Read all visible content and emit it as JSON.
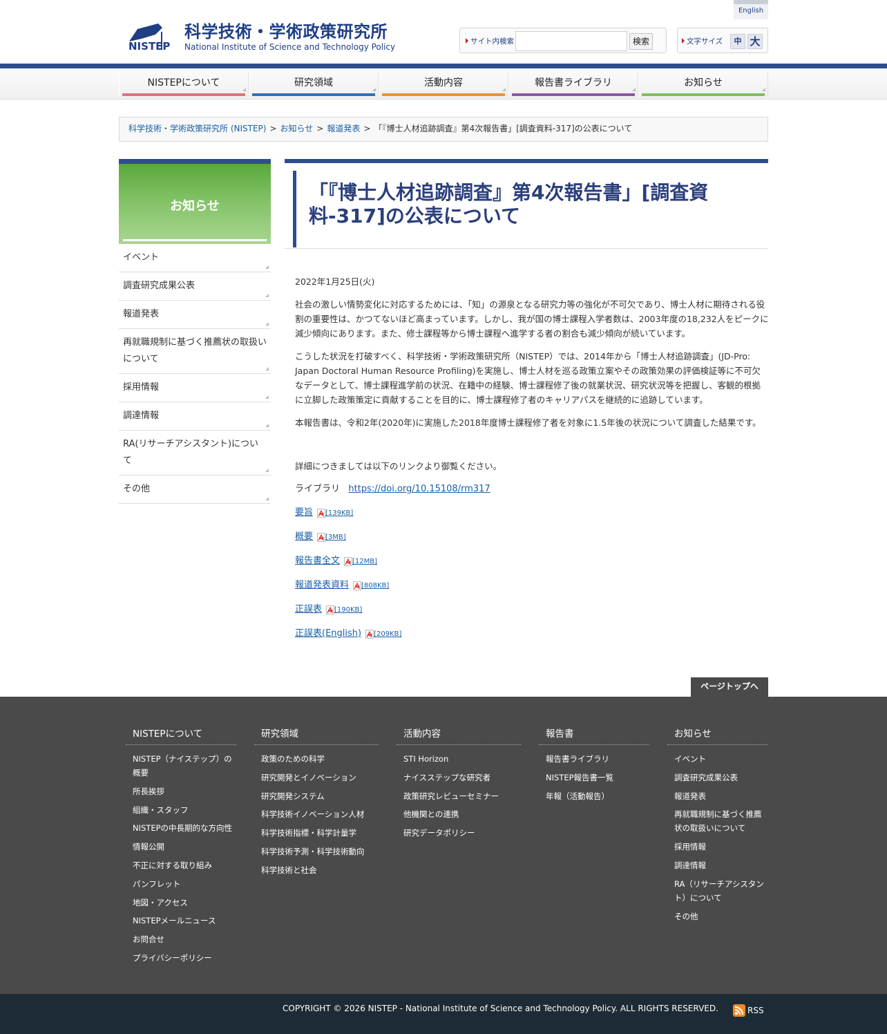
{
  "header": {
    "logo_ja": "科学技術・学術政策研究所",
    "logo_en": "National Institute of Science and Technology Policy",
    "logo_mark": "NISTEP",
    "english_link": "English",
    "search_label": "サイト内検索",
    "search_value": "",
    "search_button": "検索",
    "fontsize_label": "文字サイズ",
    "fontsize_mid": "中",
    "fontsize_big": "大"
  },
  "nav": {
    "items": [
      {
        "label": "NISTEPについて",
        "color": "#e0707a"
      },
      {
        "label": "研究領域",
        "color": "#2f6fb8"
      },
      {
        "label": "活動内容",
        "color": "#e8933a"
      },
      {
        "label": "報告書ライブラリ",
        "color": "#8a57a8"
      },
      {
        "label": "お知らせ",
        "color": "#7fbf5a"
      }
    ]
  },
  "breadcrumb": {
    "items": [
      "科学技術・学術政策研究所 (NISTEP)",
      "お知らせ",
      "報道発表"
    ],
    "current": "「『博士人材追跡調査』第4次報告書」[調査資料-317]の公表について",
    "sep": ">"
  },
  "sidebar": {
    "title": "お知らせ",
    "items": [
      {
        "label": "イベント"
      },
      {
        "label": "調査研究成果公表"
      },
      {
        "label": "報道発表"
      },
      {
        "label": "再就職規制に基づく推薦状の取扱いについて"
      },
      {
        "label": "採用情報"
      },
      {
        "label": "調達情報"
      },
      {
        "label": "RA(リサーチアシスタント)について"
      },
      {
        "label": "その他"
      }
    ]
  },
  "main": {
    "title": "「『博士人材追跡調査』第4次報告書」[調査資料-317]の公表について",
    "date": "2022年1月25日(火)",
    "paragraphs": [
      "社会の激しい情勢変化に対応するためには、「知」の源泉となる研究力等の強化が不可欠であり、博士人材に期待される役割の重要性は、かつてないほど高まっています。しかし、我が国の博士課程入学者数は、2003年度の18,232人をピークに減少傾向にあります。また、修士課程等から博士課程へ進学する者の割合も減少傾向が続いています。",
      "こうした状況を打破すべく、科学技術・学術政策研究所（NISTEP）では、2014年から「博士人材追跡調査」(JD-Pro: Japan Doctoral Human Resource Profiling)を実施し、博士人材を巡る政策立案やその政策効果の評価検証等に不可欠なデータとして、博士課程進学前の状況、在籍中の経験、博士課程修了後の就業状況、研究状況等を把握し、客観的根拠に立脚した政策策定に貢献することを目的に、博士課程修了者のキャリアパスを継続的に追跡しています。",
      "本報告書は、令和2年(2020年)に実施した2018年度博士課程修了者を対象に1.5年後の状況について調査した結果です。"
    ],
    "detail_text": "詳細につきましては以下のリンクより御覧ください。",
    "library_label": "ライブラリ",
    "library_url": "https://doi.org/10.15108/rm317",
    "links": [
      {
        "label": "要旨",
        "size": "[139KB]"
      },
      {
        "label": "概要",
        "size": "[3MB]"
      },
      {
        "label": "報告書全文",
        "size": "[12MB]"
      },
      {
        "label": "報道発表資料",
        "size": "[808KB]"
      },
      {
        "label": "正誤表",
        "size": "[190KB]"
      },
      {
        "label": "正誤表(English)",
        "size": "[209KB]"
      }
    ],
    "pagetop": "ページトップへ"
  },
  "footer": {
    "columns": [
      {
        "title": "NISTEPについて",
        "items": [
          "NISTEP（ナイステップ）の概要",
          "所長挨拶",
          "組織・スタッフ",
          "NISTEPの中長期的な方向性",
          "情報公開",
          "不正に対する取り組み",
          "パンフレット",
          "地図・アクセス",
          "NISTEPメールニュース",
          "お問合せ",
          "プライバシーポリシー"
        ]
      },
      {
        "title": "研究領域",
        "items": [
          "政策のための科学",
          "研究開発とイノベーション",
          "研究開発システム",
          "科学技術イノベーション人材",
          "科学技術指標・科学計量学",
          "科学技術予測・科学技術動向",
          "科学技術と社会"
        ]
      },
      {
        "title": "活動内容",
        "items": [
          "STI Horizon",
          "ナイスステップな研究者",
          "政策研究レビューセミナー",
          "他機関との連携",
          "研究データポリシー"
        ]
      },
      {
        "title": "報告書",
        "items": [
          "報告書ライブラリ",
          "NISTEP報告書一覧",
          "年報（活動報告）"
        ]
      },
      {
        "title": "お知らせ",
        "items": [
          "イベント",
          "調査研究成果公表",
          "報道発表",
          "再就職規制に基づく推薦状の取扱いについて",
          "採用情報",
          "調達情報",
          "RA（リサーチアシスタント）について",
          "その他"
        ]
      }
    ],
    "copyright": "COPYRIGHT © 2026 NISTEP - National Institute of Science and Technology Policy. ALL RIGHTS RESERVED.",
    "rss": "RSS"
  }
}
